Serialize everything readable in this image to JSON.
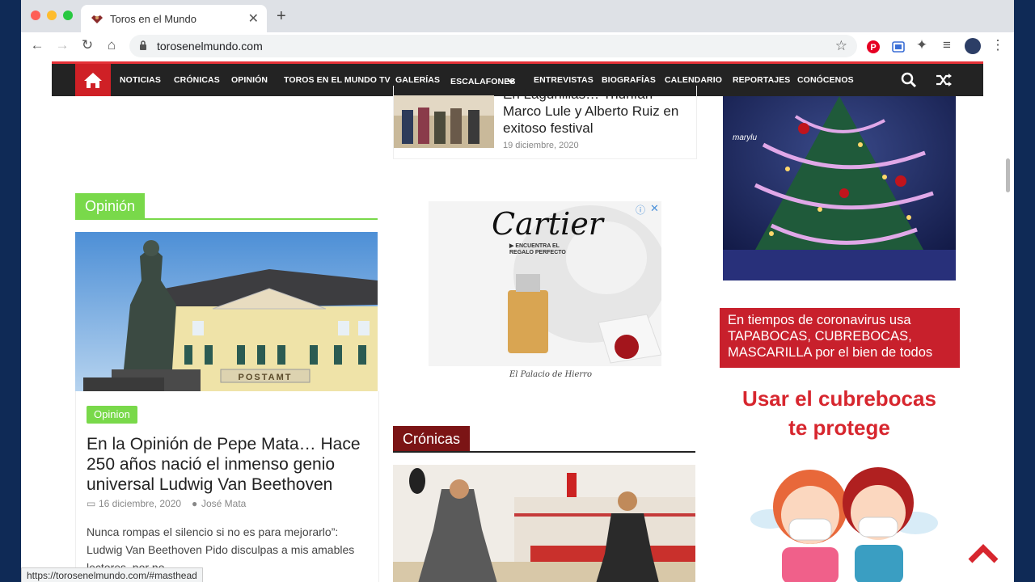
{
  "browser": {
    "tab_title": "Toros en el Mundo",
    "new_tab": "+",
    "close": "✕",
    "url": "torosenelmundo.com",
    "status_url": "https://torosenelmundo.com/#masthead"
  },
  "nav": {
    "items": [
      "NOTICIAS",
      "CRÓNICAS",
      "OPINIÓN",
      "TOROS EN EL MUNDO TV",
      "GALERÍAS",
      "ESCALAFONES",
      "ENTREVISTAS",
      "BIOGRAFÍAS",
      "CALENDARIO",
      "REPORTAJES",
      "CONÓCENOS"
    ]
  },
  "opinion": {
    "section_title": "Opinión",
    "badge": "Opinion",
    "headline": "En la Opinión de Pepe Mata… Hace 250 años nació el inmenso genio universal Ludwig Van Beethoven",
    "date": "16 diciembre, 2020",
    "author": "José Mata",
    "excerpt": "Nunca rompas el silencio si no es para mejorarlo”: Ludwig Van Beethoven Pido disculpas a mis amables lectores, por no",
    "image_sign": "POSTAMT"
  },
  "middle": {
    "headline": "En Lagunillas… Triunfan Marco Lule y Alberto Ruiz en exitoso festival",
    "date": "19 diciembre, 2020",
    "ad_brand": "Cartier",
    "ad_tagline_1": "▶ ENCUENTRA EL",
    "ad_tagline_2": "REGALO PERFECTO",
    "ad_footer": "El Palacio de Hierro",
    "cronicas_title": "Crónicas"
  },
  "right": {
    "xmas_caption": "marylu",
    "corona_text": "En tiempos de coronavirus usa TAPABOCAS, CUBREBOCAS, MASCARILLA por el bien de todos",
    "cubre_line1": "Usar el cubrebocas",
    "cubre_line2": "te protege"
  },
  "colors": {
    "accent_red": "#cf2026",
    "opinion_green": "#79d94a",
    "cronicas_maroon": "#7b1415",
    "navbar": "#232323"
  }
}
